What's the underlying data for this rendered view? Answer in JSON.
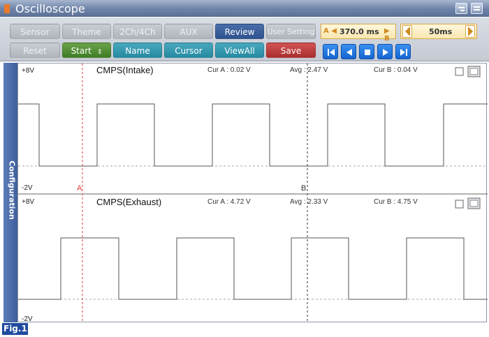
{
  "window": {
    "title": "Oscilloscope"
  },
  "toolbar": {
    "row1": [
      "Sensor",
      "Theme",
      "2Ch/4Ch",
      "AUX",
      "Review",
      "User Setting"
    ],
    "row2": [
      "Reset",
      "Start",
      "Name",
      "Cursor",
      "ViewAll",
      "Save"
    ],
    "cursor_a_marker": "A",
    "cursor_b_marker": "B",
    "cursor_delta": "370.0 ms",
    "time_div": "50ms"
  },
  "side_tab": {
    "label": "Configuration"
  },
  "channels": [
    {
      "name": "CMPS(Intake)",
      "top_label": "+8V",
      "bottom_label": "-2V",
      "cur_a": "Cur A : 0.02 V",
      "avg": "Avg : 2.47 V",
      "cur_b": "Cur B : 0.04 V"
    },
    {
      "name": "CMPS(Exhaust)",
      "top_label": "+8V",
      "bottom_label": "-2V",
      "cur_a": "Cur A : 4.72 V",
      "avg": "Avg : 2.33 V",
      "cur_b": "Cur B : 4.75 V"
    }
  ],
  "figure_label": "Fig.1",
  "colors": {
    "cursor_a": "#e23a3a",
    "cursor_b": "#333333",
    "trace": "#555555",
    "accent": "#2f5390"
  }
}
